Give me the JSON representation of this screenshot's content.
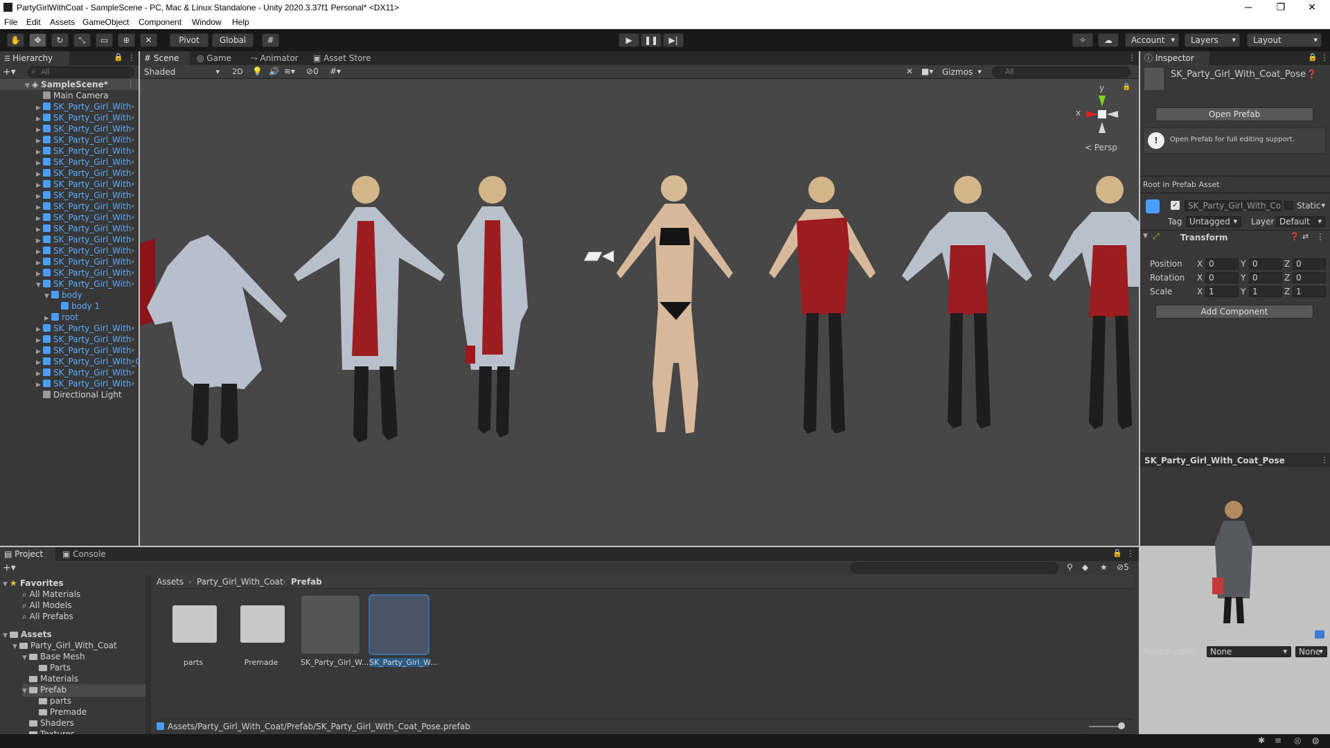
{
  "window": {
    "title": "PartyGirlWithCoat - SampleScene - PC, Mac & Linux Standalone - Unity 2020.3.37f1 Personal* <DX11>",
    "minimize": "─",
    "maximize": "❐",
    "close": "✕"
  },
  "menu": [
    "File",
    "Edit",
    "Assets",
    "GameObject",
    "Component",
    "Window",
    "Help"
  ],
  "toolbar": {
    "pivot": "Pivot",
    "global": "Global",
    "account": "Account",
    "layers": "Layers",
    "layout": "Layout"
  },
  "hierarchy": {
    "tab": "Hierarchy",
    "search_placeholder": "All",
    "scene": "SampleScene*",
    "items": [
      {
        "label": "Main Camera"
      },
      {
        "label": "SK_Party_Girl_With"
      },
      {
        "label": "SK_Party_Girl_With"
      },
      {
        "label": "SK_Party_Girl_With"
      },
      {
        "label": "SK_Party_Girl_With"
      },
      {
        "label": "SK_Party_Girl_With"
      },
      {
        "label": "SK_Party_Girl_With"
      },
      {
        "label": "SK_Party_Girl_With"
      },
      {
        "label": "SK_Party_Girl_With"
      },
      {
        "label": "SK_Party_Girl_With"
      },
      {
        "label": "SK_Party_Girl_With"
      },
      {
        "label": "SK_Party_Girl_With"
      },
      {
        "label": "SK_Party_Girl_With"
      },
      {
        "label": "SK_Party_Girl_With"
      },
      {
        "label": "SK_Party_Girl_With"
      },
      {
        "label": "SK_Party_Girl_With"
      },
      {
        "label": "SK_Party_Girl_With"
      },
      {
        "label": "SK_Party_Girl_With"
      },
      {
        "label": "body"
      },
      {
        "label": "body 1"
      },
      {
        "label": "root"
      },
      {
        "label": "SK_Party_Girl_With"
      },
      {
        "label": "SK_Party_Girl_With"
      },
      {
        "label": "SK_Party_Girl_With"
      },
      {
        "label": "SK_Party_Girl_With_Co"
      },
      {
        "label": "SK_Party_Girl_With"
      },
      {
        "label": "SK_Party_Girl_With"
      },
      {
        "label": "Directional Light"
      }
    ]
  },
  "scene_view": {
    "tabs": [
      "Scene",
      "Game",
      "Animator",
      "Asset Store"
    ],
    "shading": "Shaded",
    "mode_2d": "2D",
    "hidden_count": "0",
    "gizmos": "Gizmos",
    "search_placeholder": "All",
    "persp": "< Persp",
    "axis_x": "x",
    "axis_y": "y"
  },
  "inspector": {
    "tab": "Inspector",
    "asset_name": "SK_Party_Girl_With_Coat_Pose",
    "open_prefab": "Open Prefab",
    "info": "Open Prefab for full editing support.",
    "root_label": "Root in Prefab Asset",
    "object_name": "SK_Party_Girl_With_Co",
    "static": "Static",
    "tag_label": "Tag",
    "tag_value": "Untagged",
    "layer_label": "Layer",
    "layer_value": "Default",
    "transform": "Transform",
    "rows": [
      {
        "label": "Position",
        "x": "0",
        "y": "0",
        "z": "0"
      },
      {
        "label": "Rotation",
        "x": "0",
        "y": "0",
        "z": "0"
      },
      {
        "label": "Scale",
        "x": "1",
        "y": "1",
        "z": "1"
      }
    ],
    "axis_x": "X",
    "axis_y": "Y",
    "axis_z": "Z",
    "add_component": "Add Component",
    "preview_title": "SK_Party_Girl_With_Coat_Pose",
    "assetbundle_label": "AssetBundle",
    "assetbundle_value": "None",
    "assetbundle_variant": "None"
  },
  "project": {
    "tabs": [
      "Project",
      "Console"
    ],
    "hidden_count": "5",
    "favorites": "Favorites",
    "fav_items": [
      "All Materials",
      "All Models",
      "All Prefabs"
    ],
    "assets_root": "Assets",
    "tree": [
      {
        "label": "Party_Girl_With_Coat",
        "level": 1
      },
      {
        "label": "Base Mesh",
        "level": 2
      },
      {
        "label": "Parts",
        "level": 3
      },
      {
        "label": "Materials",
        "level": 2
      },
      {
        "label": "Prefab",
        "level": 2
      },
      {
        "label": "parts",
        "level": 3
      },
      {
        "label": "Premade",
        "level": 3
      },
      {
        "label": "Shaders",
        "level": 2
      },
      {
        "label": "Textures",
        "level": 2
      }
    ],
    "breadcrumb": [
      "Assets",
      "Party_Girl_With_Coat",
      "Prefab"
    ],
    "assets": [
      {
        "label": "parts"
      },
      {
        "label": "Premade"
      },
      {
        "label": "SK_Party_Girl_W..."
      },
      {
        "label": "SK_Party_Girl_W..."
      }
    ],
    "path": "Assets/Party_Girl_With_Coat/Prefab/SK_Party_Girl_With_Coat_Pose.prefab"
  }
}
